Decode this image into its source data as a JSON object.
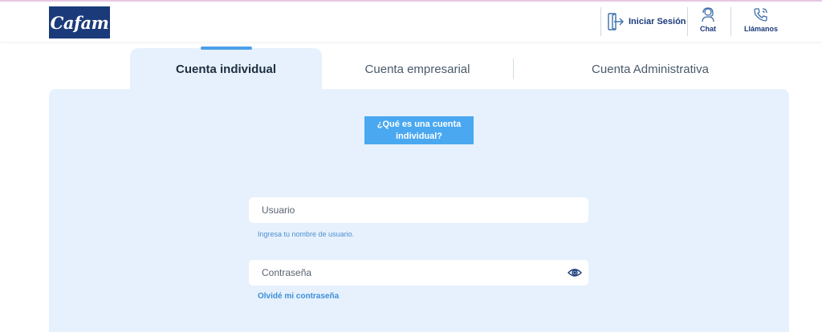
{
  "brand": {
    "logo_text": "Cafam"
  },
  "header": {
    "login_label": "Iniciar Sesión",
    "chat_label": "Chat",
    "call_label": "Llámanos"
  },
  "tabs": [
    {
      "label": "Cuenta individual",
      "active": true
    },
    {
      "label": "Cuenta empresarial",
      "active": false
    },
    {
      "label": "Cuenta Administrativa",
      "active": false
    }
  ],
  "panel": {
    "info_button": "¿Qué es una cuenta individual?",
    "username": {
      "placeholder": "Usuario",
      "helper": "Ingresa tu nombre de usuario."
    },
    "password": {
      "placeholder": "Contraseña"
    },
    "forgot_link": "Olvidé mi contraseña"
  },
  "colors": {
    "brand_navy": "#1b3a7a",
    "accent_blue": "#4aa8f0",
    "panel_bg": "#e6f1fd",
    "link_blue": "#3d8fd9"
  },
  "icons": {
    "login": "door-arrow-icon",
    "chat": "headset-agent-icon",
    "call": "phone-ringing-icon",
    "password_toggle": "eye-icon"
  }
}
